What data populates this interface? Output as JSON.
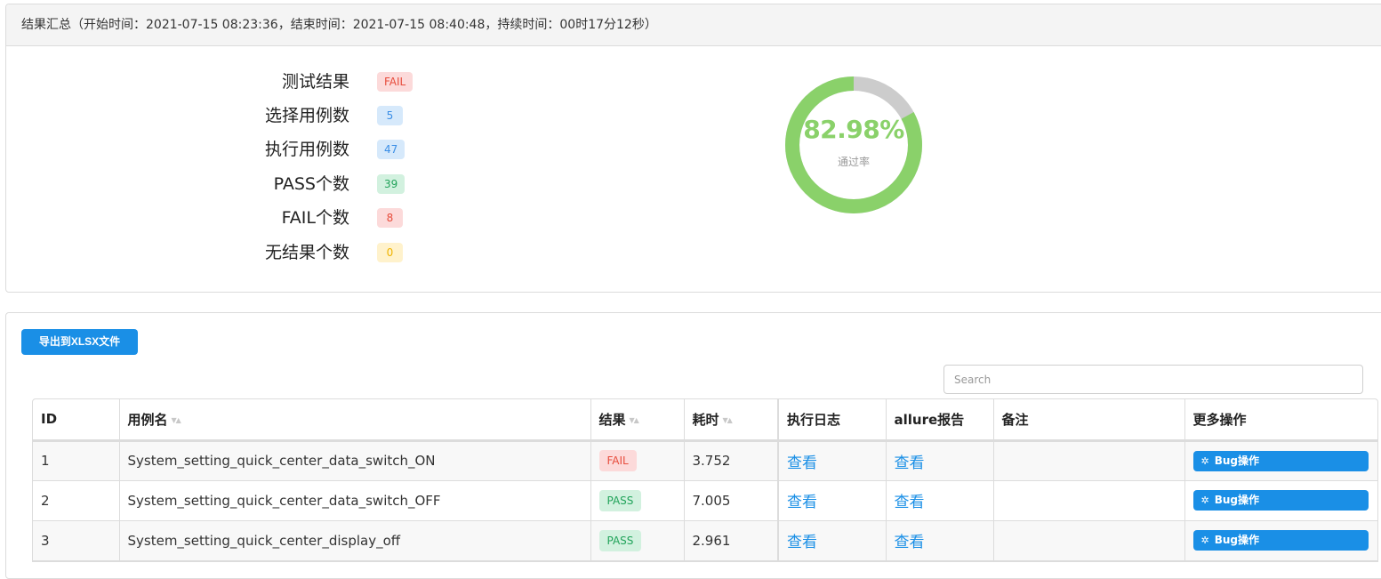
{
  "summary": {
    "heading": "结果汇总（开始时间：2021-07-15 08:23:36，结束时间：2021-07-15 08:40:48，持续时间：00时17分12秒）",
    "stats": [
      {
        "label": "测试结果",
        "value": "FAIL",
        "color": "red"
      },
      {
        "label": "选择用例数",
        "value": "5",
        "color": "blue"
      },
      {
        "label": "执行用例数",
        "value": "47",
        "color": "blue"
      },
      {
        "label": "PASS个数",
        "value": "39",
        "color": "green"
      },
      {
        "label": "FAIL个数",
        "value": "8",
        "color": "red"
      },
      {
        "label": "无结果个数",
        "value": "0",
        "color": "yellow"
      }
    ],
    "pass_rate": {
      "value_text": "82.98%",
      "label": "通过率",
      "fraction": 0.8298,
      "pass_color": "#8ad16a",
      "rest_color": "#cccccc"
    }
  },
  "results": {
    "export_label": "导出到XLSX文件",
    "search_placeholder": "Search",
    "columns": [
      {
        "label": "ID",
        "sortable": false
      },
      {
        "label": "用例名",
        "sortable": true
      },
      {
        "label": "结果",
        "sortable": true
      },
      {
        "label": "耗时",
        "sortable": true
      },
      {
        "label": "执行日志",
        "sortable": false
      },
      {
        "label": "allure报告",
        "sortable": false
      },
      {
        "label": "备注",
        "sortable": false
      },
      {
        "label": "更多操作",
        "sortable": false
      }
    ],
    "rows": [
      {
        "id": "1",
        "name": "System_setting_quick_center_data_switch_ON",
        "result": "FAIL",
        "time": "3.752",
        "log": "查看",
        "allure": "查看",
        "note": "",
        "action": "Bug操作"
      },
      {
        "id": "2",
        "name": "System_setting_quick_center_data_switch_OFF",
        "result": "PASS",
        "time": "7.005",
        "log": "查看",
        "allure": "查看",
        "note": "",
        "action": "Bug操作"
      },
      {
        "id": "3",
        "name": "System_setting_quick_center_display_off",
        "result": "PASS",
        "time": "2.961",
        "log": "查看",
        "allure": "查看",
        "note": "",
        "action": "Bug操作"
      }
    ],
    "action_icon": "bug-icon"
  }
}
